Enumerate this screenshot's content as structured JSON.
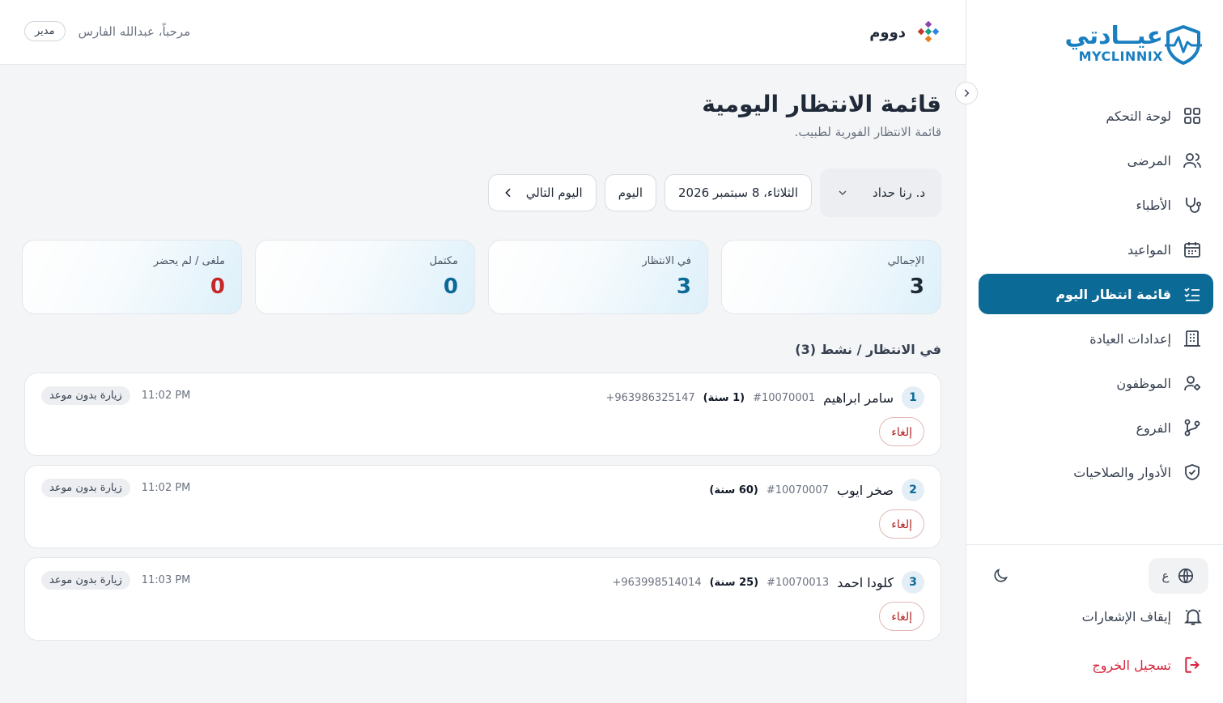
{
  "sidebar": {
    "logo_ar": "عيــادتي",
    "logo_en": "MYCLINNIX",
    "items": [
      {
        "label": "لوحة التحكم",
        "icon": "grid-icon"
      },
      {
        "label": "المرضى",
        "icon": "users-icon"
      },
      {
        "label": "الأطباء",
        "icon": "stethoscope-icon"
      },
      {
        "label": "المواعيد",
        "icon": "calendar-icon"
      },
      {
        "label": "قائمة انتظار اليوم",
        "icon": "list-check-icon",
        "active": true
      },
      {
        "label": "إعدادات العيادة",
        "icon": "building-icon"
      },
      {
        "label": "الموظفون",
        "icon": "user-gear-icon"
      },
      {
        "label": "الفروع",
        "icon": "git-branch-icon"
      },
      {
        "label": "الأدوار والصلاحيات",
        "icon": "shield-check-icon"
      }
    ],
    "lang_label": "ع",
    "notifications_label": "إيقاف الإشعارات",
    "logout_label": "تسجيل الخروج"
  },
  "topbar": {
    "brand": "دووم",
    "welcome": "مرحباً، عبدالله الفارس",
    "role": "مدير"
  },
  "page": {
    "title": "قائمة الانتظار اليومية",
    "subtitle": "قائمة الانتظار الفورية لطبيب."
  },
  "filters": {
    "doctor": "د. رنا حداد",
    "date": "الثلاثاء، 8 سبتمبر 2026",
    "today": "اليوم",
    "next_day": "اليوم التالي"
  },
  "stats": [
    {
      "label": "الإجمالي",
      "value": "3"
    },
    {
      "label": "في الانتظار",
      "value": "3"
    },
    {
      "label": "مكتمل",
      "value": "0"
    },
    {
      "label": "ملغى / لم يحضر",
      "value": "0"
    }
  ],
  "section_title": "في الانتظار / نشط (3)",
  "queue": [
    {
      "num": "1",
      "name": "سامر ابراهيم",
      "id": "#10070001",
      "age": "(1 سنة)",
      "phone": "+963986325147",
      "time": "11:02 PM",
      "type": "زيارة بدون موعد",
      "cancel": "إلغاء"
    },
    {
      "num": "2",
      "name": "صخر ايوب",
      "id": "#10070007",
      "age": "(60 سنة)",
      "phone": "",
      "time": "11:02 PM",
      "type": "زيارة بدون موعد",
      "cancel": "إلغاء"
    },
    {
      "num": "3",
      "name": "كلودا احمد",
      "id": "#10070013",
      "age": "(25 سنة)",
      "phone": "+963998514014",
      "time": "11:03 PM",
      "type": "زيارة بدون موعد",
      "cancel": "إلغاء"
    }
  ]
}
